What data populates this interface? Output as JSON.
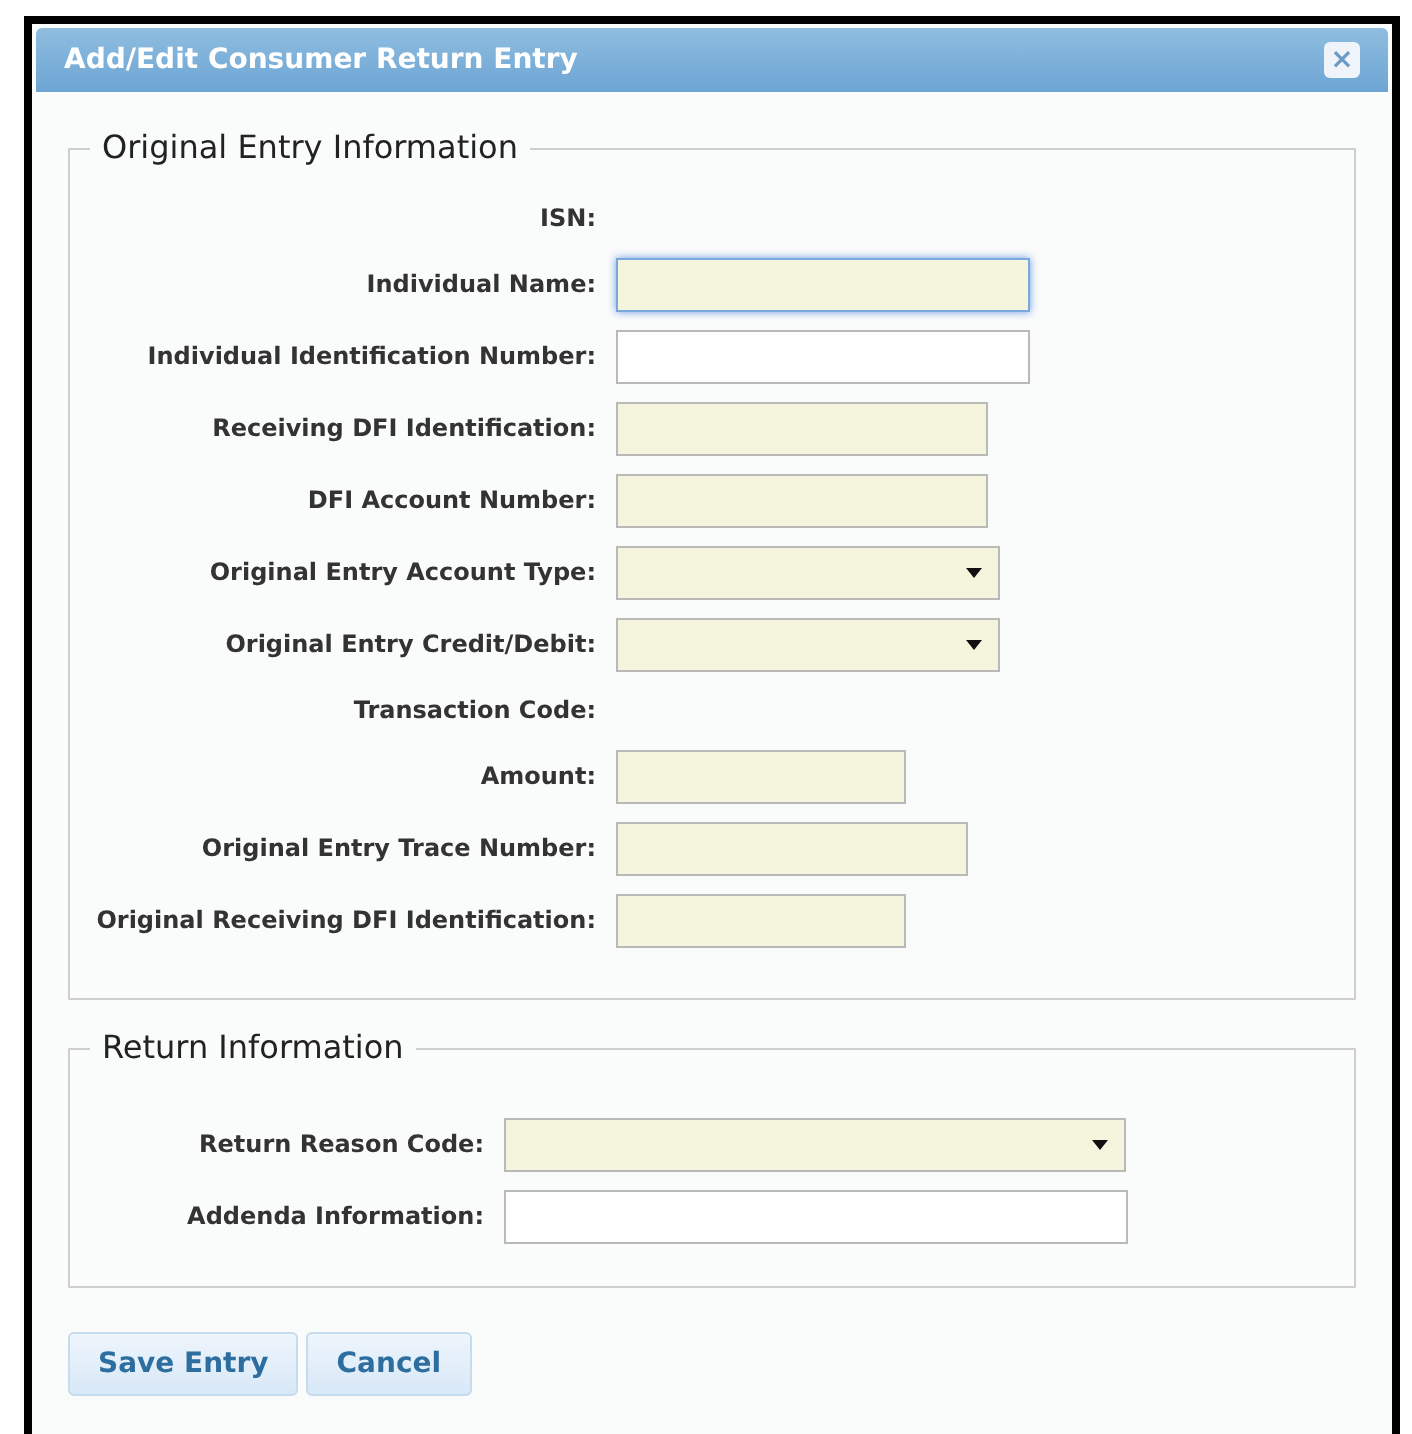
{
  "dialog": {
    "title": "Add/Edit Consumer Return Entry",
    "close_label": "×"
  },
  "sections": [
    {
      "legend": "Original Entry Information",
      "fields": [
        {
          "label": "ISN:",
          "kind": "static"
        },
        {
          "label": "Individual Name:",
          "kind": "text",
          "required": true,
          "focused": true
        },
        {
          "label": "Individual Identification Number:",
          "kind": "text",
          "required": false,
          "focused": false
        },
        {
          "label": "Receiving DFI Identification:",
          "kind": "text",
          "required": true,
          "focused": false
        },
        {
          "label": "DFI Account Number:",
          "kind": "text",
          "required": true,
          "focused": false
        },
        {
          "label": "Original Entry Account Type:",
          "kind": "select",
          "required": true,
          "focused": false
        },
        {
          "label": "Original Entry Credit/Debit:",
          "kind": "select",
          "required": true,
          "focused": false
        },
        {
          "label": "Transaction Code:",
          "kind": "static"
        },
        {
          "label": "Amount:",
          "kind": "text",
          "required": true,
          "focused": false
        },
        {
          "label": "Original Entry Trace Number:",
          "kind": "text",
          "required": true,
          "focused": false
        },
        {
          "label": "Original Receiving DFI Identification:",
          "kind": "text",
          "required": true,
          "focused": false
        }
      ]
    },
    {
      "legend": "Return Information",
      "fields": [
        {
          "label": "Return Reason Code:",
          "kind": "select",
          "required": true,
          "focused": false
        },
        {
          "label": "Addenda Information:",
          "kind": "text",
          "required": false,
          "focused": false
        }
      ]
    }
  ],
  "buttons": [
    "Save Entry",
    "Cancel"
  ]
}
